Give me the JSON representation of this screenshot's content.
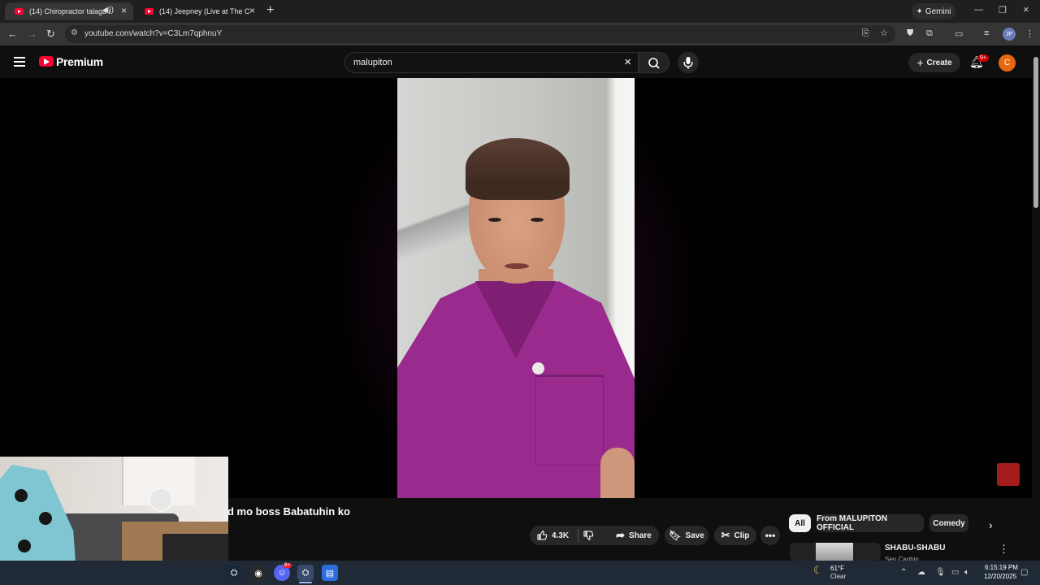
{
  "browser": {
    "tabs": [
      {
        "title": "(14) Chiropractor talaga ako",
        "active": true,
        "audio": true
      },
      {
        "title": "(14) Jeepney (Live at The Cozy C",
        "active": false,
        "audio": false
      }
    ],
    "new_tab": "+",
    "gemini_label": "Gemini",
    "url": "youtube.com/watch?v=C3Lm7qphnuY",
    "profile_initials": "JP"
  },
  "youtube": {
    "brand": "Premium",
    "search_value": "malupiton",
    "create_label": "Create",
    "notification_count": "9+",
    "avatar_letter": "C"
  },
  "video": {
    "title_visible": "d mo boss Babatuhin ko",
    "likes": "4.3K",
    "share_label": "Share",
    "save_label": "Save",
    "clip_label": "Clip"
  },
  "chips": [
    "All",
    "From MALUPITON OFFICIAL",
    "Comedy"
  ],
  "recommendation": {
    "title": "SHABU-SHABU",
    "channel": "Sen Cagbin"
  },
  "taskbar": {
    "weather_temp": "61°F",
    "weather_condition": "Clear",
    "time": "6:15:19 PM",
    "date": "12/20/2025",
    "discord_badge": "9+"
  },
  "colors": {
    "youtube_red": "#ff0033",
    "shirt": "#9b2a8f",
    "avatar": "#e8680f",
    "taskbar": "#202a36"
  }
}
